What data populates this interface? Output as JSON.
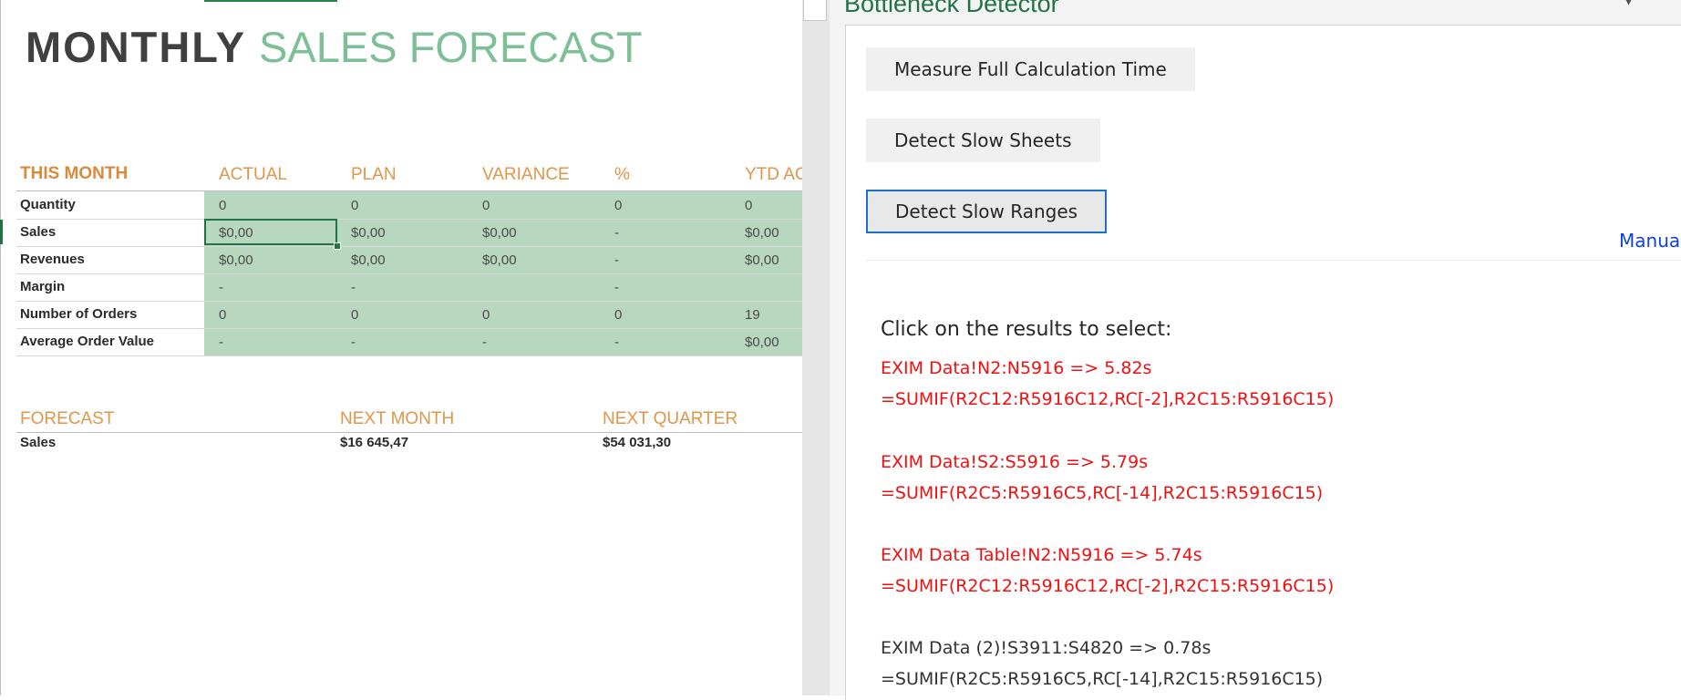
{
  "sheet": {
    "title_bold": "MONTHLY",
    "title_light": "SALES FORECAST",
    "this_month": {
      "section_label": "THIS MONTH",
      "columns": [
        "ACTUAL",
        "PLAN",
        "VARIANCE",
        "%",
        "YTD AC"
      ],
      "rows": [
        {
          "label": "Quantity",
          "values": [
            "0",
            "0",
            "0",
            "0",
            "0"
          ]
        },
        {
          "label": "Sales",
          "values": [
            "$0,00",
            "$0,00",
            "$0,00",
            "-",
            "$0,00"
          ]
        },
        {
          "label": "Revenues",
          "values": [
            "$0,00",
            "$0,00",
            "$0,00",
            "-",
            "$0,00"
          ]
        },
        {
          "label": "Margin",
          "values": [
            "-",
            "-",
            "",
            "-",
            ""
          ]
        },
        {
          "label": "Number of Orders",
          "values": [
            "0",
            "0",
            "0",
            "0",
            "19"
          ]
        },
        {
          "label": "Average Order Value",
          "values": [
            "-",
            "-",
            "-",
            "-",
            "$0,00"
          ]
        }
      ]
    },
    "forecast": {
      "section_label": "FORECAST",
      "columns": [
        "NEXT MONTH",
        "NEXT QUARTER"
      ],
      "rows": [
        {
          "label": "Sales",
          "values": [
            "$16 645,47",
            "$54 031,30"
          ]
        }
      ]
    }
  },
  "pane": {
    "title": "Bottleneck Detector",
    "chevron_icon": "chevron-down-icon",
    "buttons": {
      "measure": "Measure Full Calculation Time",
      "slow_sheets": "Detect Slow Sheets",
      "slow_ranges": "Detect Slow Ranges"
    },
    "manual_link": "Manual",
    "results_intro": "Click on the results to select:",
    "results": [
      {
        "range": "EXIM Data!N2:N5916 => 5.82s",
        "formula": "=SUMIF(R2C12:R5916C12,RC[-2],R2C15:R5916C15)",
        "color": "#f01010"
      },
      {
        "range": "EXIM Data!S2:S5916 => 5.79s",
        "formula": "=SUMIF(R2C5:R5916C5,RC[-14],R2C15:R5916C15)",
        "color": "#f01010"
      },
      {
        "range": "EXIM Data Table!N2:N5916 => 5.74s",
        "formula": "=SUMIF(R2C12:R5916C12,RC[-2],R2C15:R5916C15)",
        "color": "#f01010"
      },
      {
        "range": "EXIM Data (2)!S3911:S4820 => 0.78s",
        "formula": "=SUMIF(R2C5:R5916C5,RC[-14],R2C15:R5916C15)",
        "color": "#333333"
      }
    ]
  },
  "colors": {
    "accent_green": "#217346",
    "header_orange": "#e0964a",
    "cell_green": "#b7d7bf",
    "title_light_green": "#7fbf97",
    "link_blue": "#1040e0",
    "focus_blue": "#1e6fc9",
    "slow_red": "#f01010"
  }
}
